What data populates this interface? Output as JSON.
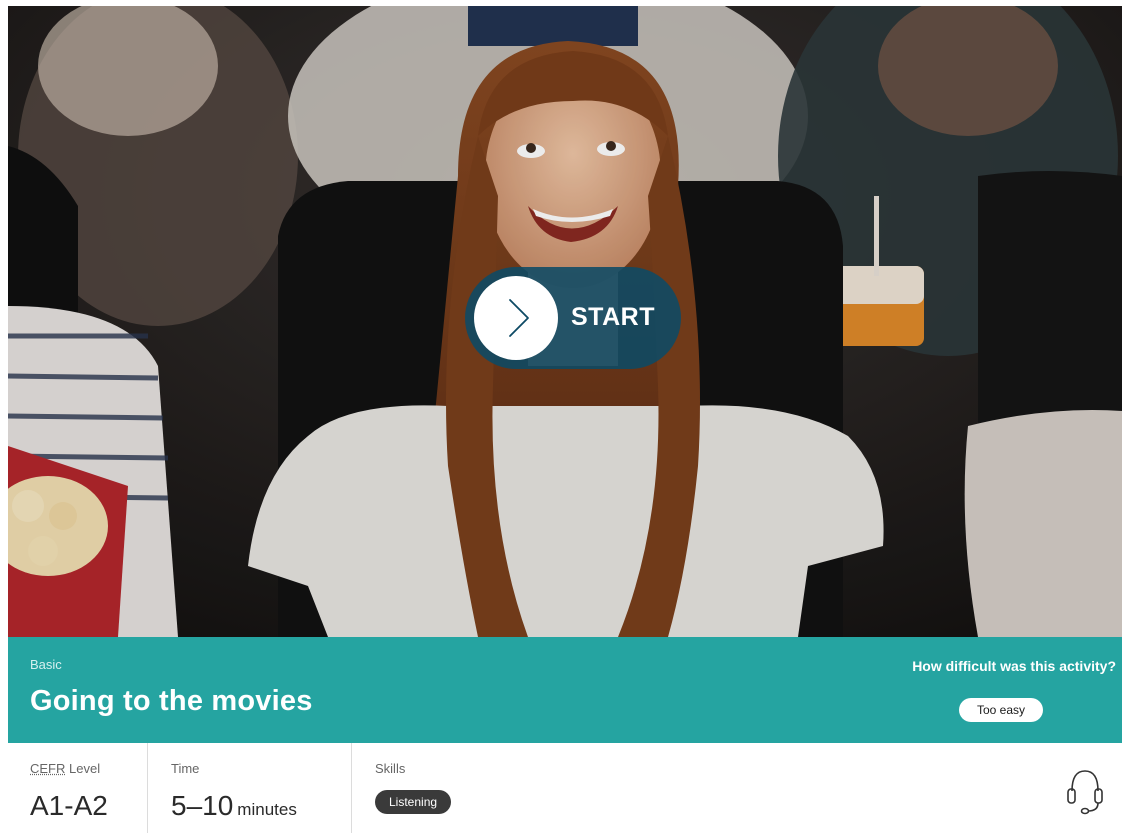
{
  "hero": {
    "start_label": "START",
    "start_icon": "chevron-right-icon"
  },
  "activity": {
    "level_tag": "Basic",
    "title": "Going to the movies"
  },
  "feedback": {
    "question": "How difficult was this activity?",
    "option_label": "Too easy"
  },
  "details": {
    "cefr": {
      "label_abbr": "CEFR",
      "label_rest": " Level",
      "value": "A1-A2"
    },
    "time": {
      "label": "Time",
      "value": "5–10",
      "unit": "minutes"
    },
    "skills": {
      "label": "Skills",
      "items": [
        "Listening"
      ],
      "icon": "headphones-icon"
    }
  },
  "colors": {
    "accent_teal": "#25a4a1",
    "start_button_bg": "#0d4a65",
    "pill_dark": "#3a3a3a"
  }
}
